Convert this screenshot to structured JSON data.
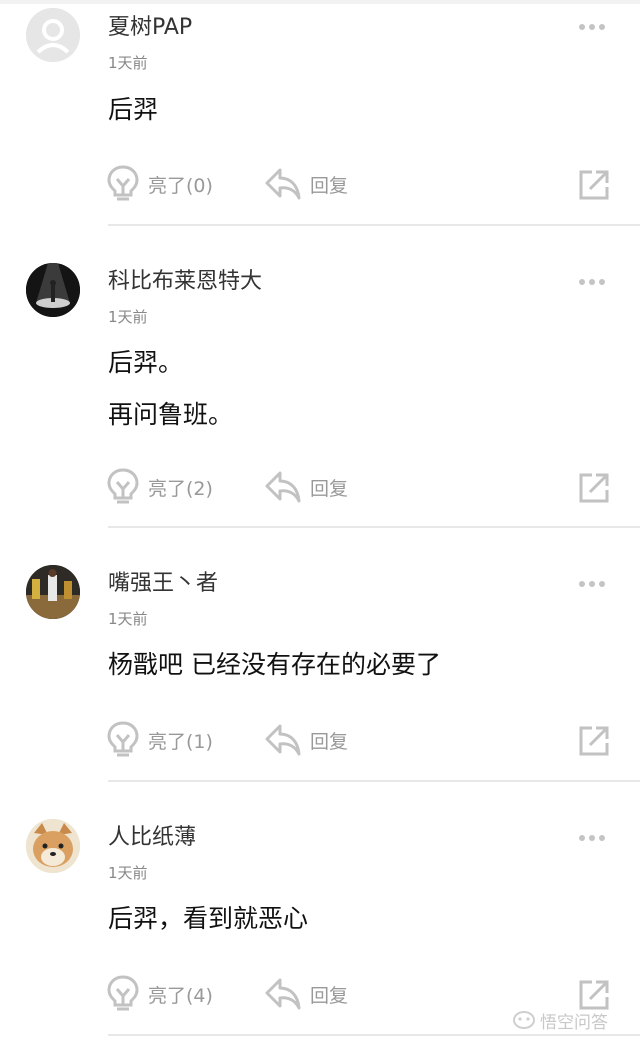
{
  "comments": [
    {
      "name": "夏树PAP",
      "time": "1天前",
      "lines": [
        "后羿"
      ],
      "like": "亮了(0)",
      "reply": "回复",
      "avatar": "default-avatar"
    },
    {
      "name": "科比布莱恩特大",
      "time": "1天前",
      "lines": [
        "后羿。",
        "再问鲁班。"
      ],
      "like": "亮了(2)",
      "reply": "回复",
      "avatar": "spotlight-avatar"
    },
    {
      "name": "嘴强王丶者",
      "time": "1天前",
      "lines": [
        "杨戬吧 已经没有存在的必要了"
      ],
      "like": "亮了(1)",
      "reply": "回复",
      "avatar": "basketball-avatar"
    },
    {
      "name": "人比纸薄",
      "time": "1天前",
      "lines": [
        "后羿，看到就恶心"
      ],
      "like": "亮了(4)",
      "reply": "回复",
      "avatar": "shiba-dog-avatar"
    }
  ],
  "icons": {
    "more": "more-dots-icon",
    "like": "lightbulb-icon",
    "reply": "reply-arrow-icon",
    "share": "share-icon"
  },
  "watermark": {
    "text": "悟空问答",
    "icon": "wukong-logo-icon"
  },
  "colors": {
    "divider": "#e8e8e8",
    "icon_gray": "#bdbdbd",
    "text_gray": "#999999"
  }
}
